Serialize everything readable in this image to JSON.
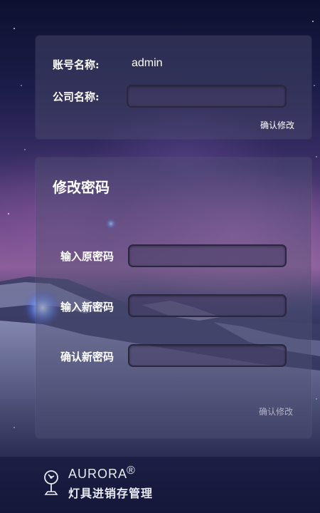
{
  "account": {
    "username_label": "账号名称:",
    "username_value": "admin",
    "company_label": "公司名称:",
    "company_value": "",
    "confirm_label": "确认修改"
  },
  "password": {
    "title": "修改密码",
    "old_label": "输入原密码",
    "new_label": "输入新密码",
    "repeat_label": "确认新密码",
    "old_value": "",
    "new_value": "",
    "repeat_value": "",
    "confirm_label": "确认修改"
  },
  "footer": {
    "brand_en": "AURORA",
    "brand_mark": "®",
    "brand_cn": "灯具进销存管理",
    "logo_icon": "lamp-icon"
  },
  "colors": {
    "primary_text": "#ffffff",
    "muted_button": "#b3b3c6",
    "footer_bg": "#1b1f43"
  }
}
